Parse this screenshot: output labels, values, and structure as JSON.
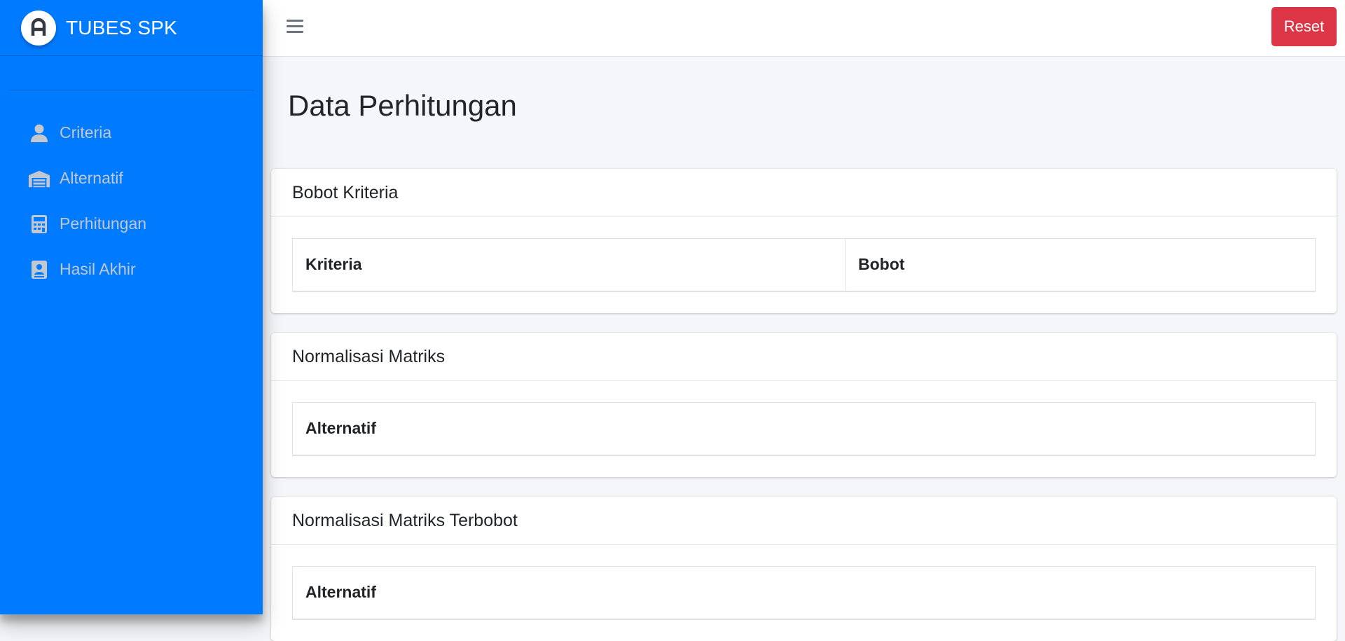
{
  "brand": {
    "title": "TUBES SPK",
    "logo_icon": "letter-a-logo-icon"
  },
  "sidebar": {
    "items": [
      {
        "label": "Criteria",
        "icon": "user-icon"
      },
      {
        "label": "Alternatif",
        "icon": "warehouse-icon"
      },
      {
        "label": "Perhitungan",
        "icon": "calculator-icon"
      },
      {
        "label": "Hasil Akhir",
        "icon": "contact-card-icon"
      }
    ]
  },
  "topbar": {
    "menu_icon": "hamburger-menu-icon",
    "reset_label": "Reset"
  },
  "page": {
    "title": "Data Perhitungan"
  },
  "cards": [
    {
      "title": "Bobot Kriteria",
      "columns": [
        "Kriteria",
        "Bobot"
      ]
    },
    {
      "title": "Normalisasi Matriks",
      "columns": [
        "Alternatif"
      ]
    },
    {
      "title": "Normalisasi Matriks Terbobot",
      "columns": [
        "Alternatif"
      ]
    }
  ],
  "colors": {
    "sidebar": "#007bff",
    "reset_button": "#dc3545",
    "nav_text": "#c2c7d0",
    "content_bg": "#f4f6f9"
  }
}
